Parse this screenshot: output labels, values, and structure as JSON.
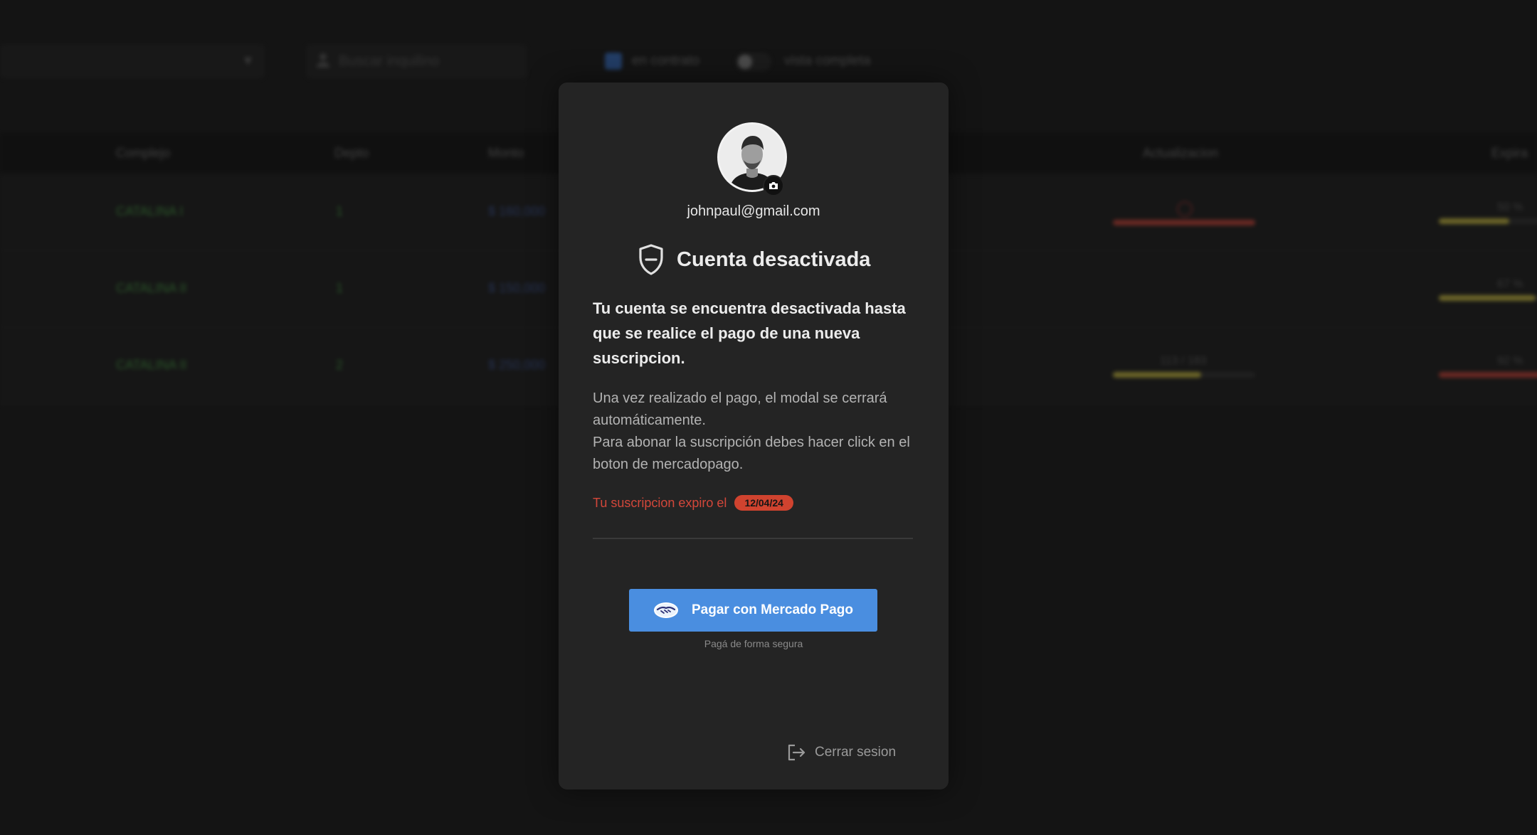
{
  "background": {
    "search_placeholder": "Buscar inquilino",
    "checkbox_label": "en contrato",
    "toggle_label": "vista completa",
    "table_headers": [
      "Complejo",
      "Depto",
      "Monto",
      "Actualizacion",
      "Expira"
    ],
    "rows": [
      {
        "complejo": "CATALINA I",
        "depto": "1",
        "monto": "$ 160,000",
        "actualizacion_progress": 1.0,
        "expira_label": "50 %",
        "expira_progress": 0.5
      },
      {
        "complejo": "CATALINA II",
        "depto": "1",
        "monto": "$ 150,000",
        "actualizacion_progress": null,
        "expira_label": "67 %",
        "expira_progress": 0.67
      },
      {
        "complejo": "CATALINA II",
        "depto": "2",
        "monto": "$ 250,000",
        "actualizacion_label": "113 / 183",
        "actualizacion_progress": 0.62,
        "expira_label": "92 %",
        "expira_progress": 0.92
      }
    ]
  },
  "modal": {
    "email": "johnpaul@gmail.com",
    "title": "Cuenta desactivada",
    "lead": "Tu cuenta se encuentra desactivada hasta que se realice el pago de una nueva suscripcion.",
    "body_line1": "Una vez realizado el pago, el modal se cerrará automáticamente.",
    "body_line2": "Para abonar la suscripción debes hacer click en el boton de mercadopago.",
    "expired_text": "Tu suscripcion expiro el",
    "expired_date": "12/04/24",
    "pay_button": "Pagar con Mercado Pago",
    "secure_text": "Pagá de forma segura",
    "logout": "Cerrar sesion"
  },
  "colors": {
    "accent": "#4a8ee0",
    "danger": "#d0432f",
    "modal_bg": "#242424",
    "page_bg": "#141414"
  },
  "icons": [
    "user-icon",
    "shield-icon",
    "camera-icon",
    "handshake-icon",
    "logout-icon"
  ]
}
